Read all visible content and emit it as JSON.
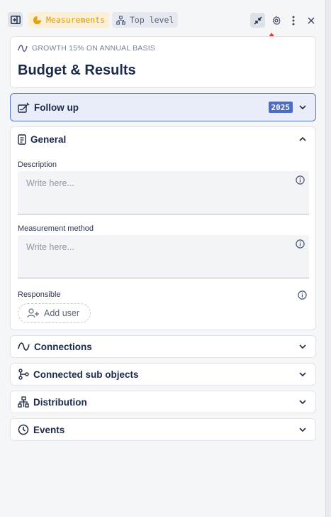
{
  "toolbar": {
    "tags": [
      {
        "label": "Measurements",
        "icon": "pie-chart-icon",
        "color": "#d99a11"
      },
      {
        "label": "Top level",
        "icon": "hierarchy-icon",
        "color": "#56607a"
      }
    ]
  },
  "header": {
    "subtitle": "GROWTH 15% ON ANNUAL BASIS",
    "title": "Budget & Results"
  },
  "follow_up": {
    "label": "Follow up",
    "year": "2025"
  },
  "general": {
    "label": "General",
    "description_label": "Description",
    "description_placeholder": "Write here...",
    "method_label": "Measurement method",
    "method_placeholder": "Write here...",
    "responsible_label": "Responsible",
    "add_user_label": "Add user"
  },
  "sections": [
    {
      "label": "Connections",
      "icon": "wave-icon"
    },
    {
      "label": "Connected sub objects",
      "icon": "branch-icon"
    },
    {
      "label": "Distribution",
      "icon": "distribution-icon"
    },
    {
      "label": "Events",
      "icon": "clock-icon"
    }
  ],
  "colors": {
    "accent": "#4d6bc9",
    "tag_measurements_bg": "#fbf0d6",
    "annotation_arrow": "#e8383d"
  }
}
